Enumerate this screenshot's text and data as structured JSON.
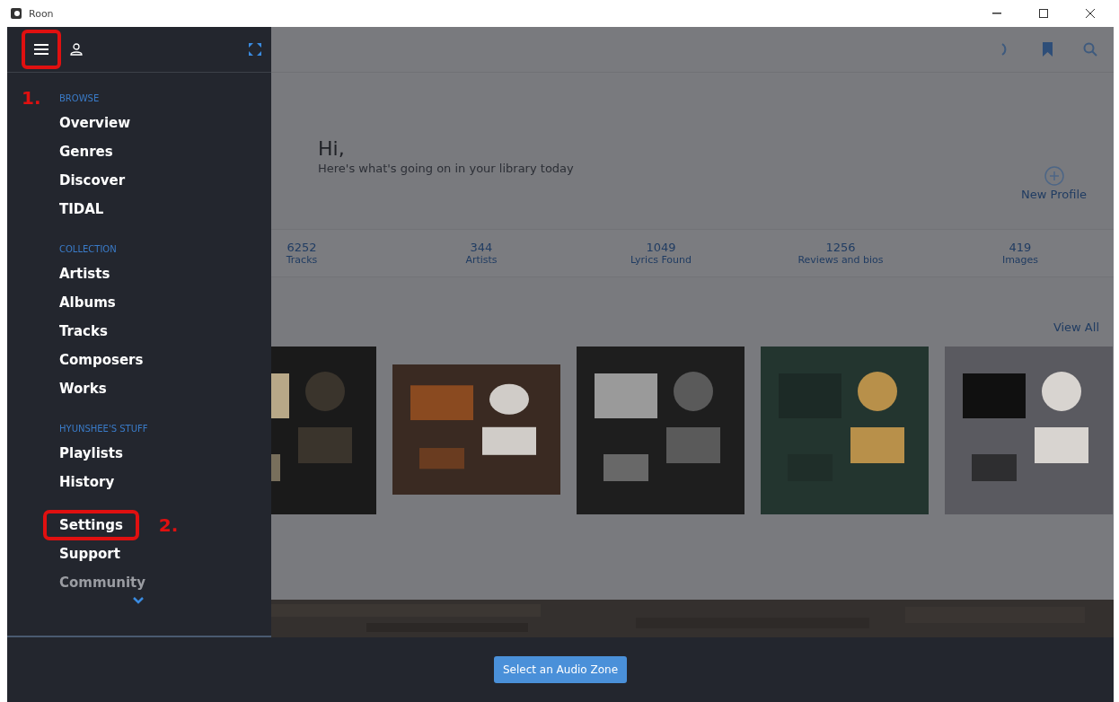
{
  "window": {
    "title": "Roon"
  },
  "sidebar": {
    "menu_annotated": true,
    "sections": [
      {
        "label": "BROWSE",
        "annotation": "1.",
        "items": [
          {
            "label": "Overview",
            "dimmed": false,
            "annotated": false
          },
          {
            "label": "Genres",
            "dimmed": false,
            "annotated": false
          },
          {
            "label": "Discover",
            "dimmed": false,
            "annotated": false
          },
          {
            "label": "TIDAL",
            "dimmed": false,
            "annotated": false
          }
        ]
      },
      {
        "label": "COLLECTION",
        "items": [
          {
            "label": "Artists",
            "dimmed": false,
            "annotated": false
          },
          {
            "label": "Albums",
            "dimmed": false,
            "annotated": false
          },
          {
            "label": "Tracks",
            "dimmed": false,
            "annotated": false
          },
          {
            "label": "Composers",
            "dimmed": false,
            "annotated": false
          },
          {
            "label": "Works",
            "dimmed": false,
            "annotated": false
          }
        ]
      },
      {
        "label": "HYUNSHEE'S STUFF",
        "items": [
          {
            "label": "Playlists",
            "dimmed": false,
            "annotated": false
          },
          {
            "label": "History",
            "dimmed": false,
            "annotated": false
          }
        ]
      },
      {
        "items": [
          {
            "label": "Settings",
            "dimmed": false,
            "annotated": true,
            "annotation": "2."
          },
          {
            "label": "Support",
            "dimmed": false,
            "annotated": false
          },
          {
            "label": "Community",
            "dimmed": true,
            "annotated": false
          }
        ]
      }
    ]
  },
  "main": {
    "greeting": "Hi,",
    "subtitle": "Here's what's going on in your library today",
    "new_profile": "New Profile",
    "stats": [
      {
        "value": "6252",
        "label": "Tracks"
      },
      {
        "value": "344",
        "label": "Artists"
      },
      {
        "value": "1049",
        "label": "Lyrics Found"
      },
      {
        "value": "1256",
        "label": "Reviews and bios"
      },
      {
        "value": "419",
        "label": "Images"
      }
    ],
    "view_all": "View All"
  },
  "footer": {
    "button": "Select an Audio Zone"
  }
}
